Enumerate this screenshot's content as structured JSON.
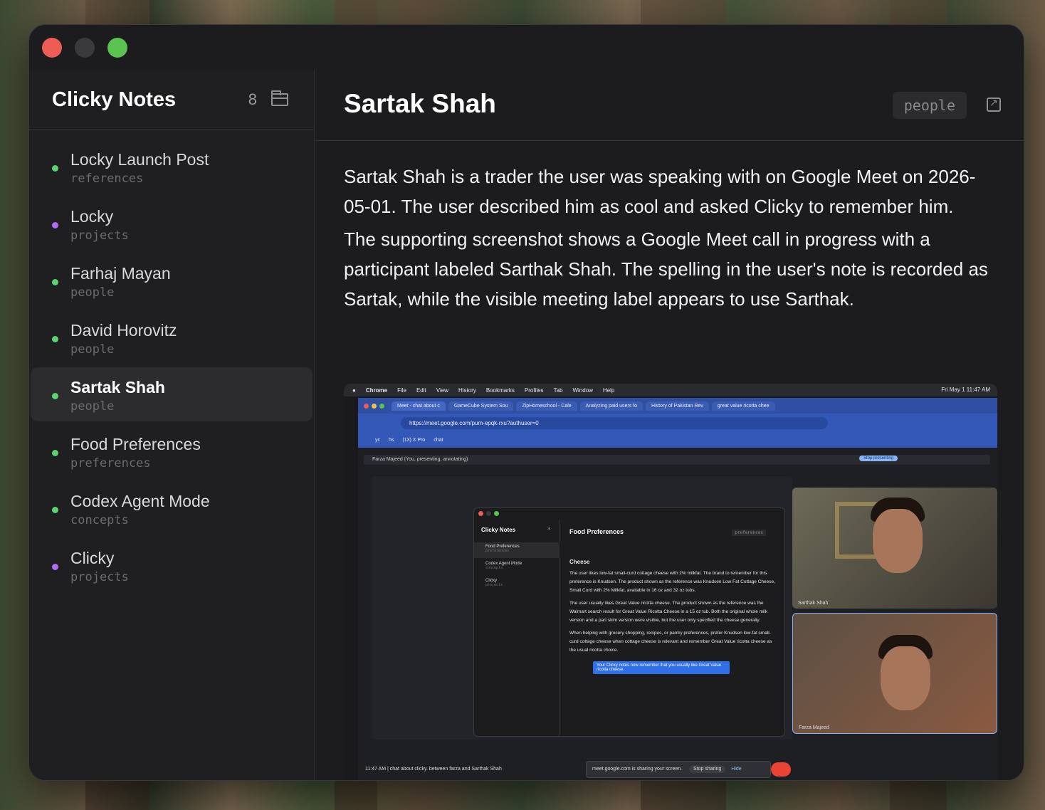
{
  "sidebar": {
    "title": "Clicky Notes",
    "count": "8",
    "items": [
      {
        "title": "Locky Launch Post",
        "tag": "references",
        "color": "#5ed36b"
      },
      {
        "title": "Locky",
        "tag": "projects",
        "color": "#b36cf0"
      },
      {
        "title": "Farhaj Mayan",
        "tag": "people",
        "color": "#5ed36b"
      },
      {
        "title": "David Horovitz",
        "tag": "people",
        "color": "#5ed36b"
      },
      {
        "title": "Sartak Shah",
        "tag": "people",
        "color": "#5ed36b"
      },
      {
        "title": "Food Preferences",
        "tag": "preferences",
        "color": "#5ed36b"
      },
      {
        "title": "Codex Agent Mode",
        "tag": "concepts",
        "color": "#5ed36b"
      },
      {
        "title": "Clicky",
        "tag": "projects",
        "color": "#b36cf0"
      }
    ]
  },
  "main": {
    "title": "Sartak Shah",
    "tag": "people",
    "paragraphs": [
      "Sartak Shah is a trader the user was speaking with on Google Meet on 2026-05-01. The user described him as cool and asked Clicky to remember him.",
      "The supporting screenshot shows a Google Meet call in progress with a participant labeled Sarthak Shah. The spelling in the user's note is recorded as Sartak, while the visible meeting label appears to use Sarthak."
    ]
  },
  "screenshot": {
    "menubar": [
      "Chrome",
      "File",
      "Edit",
      "View",
      "History",
      "Bookmarks",
      "Profiles",
      "Tab",
      "Window",
      "Help"
    ],
    "clock": "Fri May 1  11:47 AM",
    "tabs": [
      "Meet - chat about c",
      "GameCube System Sou",
      "ZipHomeschool - Cale",
      "Analyzing paid users fo",
      "History of Pakistan Rev",
      "great value ricotta chee"
    ],
    "url": "https://meet.google.com/pum-epqk-rxu?authuser=0",
    "bookmarks": [
      "yc",
      "hs",
      "(13) X Pro",
      "chat"
    ],
    "presenting": "Farza Majeed (You, presenting, annotating)",
    "stop_presenting": "Stop presenting",
    "inner_app_title": "Clicky Notes",
    "inner_count": "3",
    "inner_items": [
      {
        "title": "Food Preferences",
        "tag": "preferences"
      },
      {
        "title": "Codex Agent Mode",
        "tag": "concepts"
      },
      {
        "title": "Clicky",
        "tag": "projects"
      }
    ],
    "inner_heading": "Food Preferences",
    "inner_tag": "preferences",
    "inner_section": "Cheese",
    "inner_paragraphs": [
      "The user likes low-fat small-curd cottage cheese with 2% milkfat. The brand to remember for this preference is Knudsen. The product shown as the reference was Knudsen Low Fat Cottage Cheese, Small Curd with 2% Milkfat, available in 16 oz and 32 oz tubs.",
      "The user usually likes Great Value ricotta cheese. The product shown as the reference was the Walmart search result for Great Value Ricotta Cheese in a 15 oz tub. Both the original whole milk version and a part skim version were visible, but the user only specified the cheese generally.",
      "When helping with grocery shopping, recipes, or pantry preferences, prefer Knudsen low-fat small-curd cottage cheese when cottage cheese is relevant and remember Great Value ricotta cheese as the usual ricotta choice."
    ],
    "tooltip": "Your Clicky notes now remember that you usually like Great Value ricotta cheese.",
    "participant1": "Sarthak Shah",
    "participant2": "Farza Majeed",
    "meeting_info": "11:47 AM  |  chat about clicky. between farza and Sarthak Shah",
    "sharing_text": "meet.google.com is sharing your screen.",
    "stop_sharing": "Stop sharing",
    "hide": "Hide"
  }
}
